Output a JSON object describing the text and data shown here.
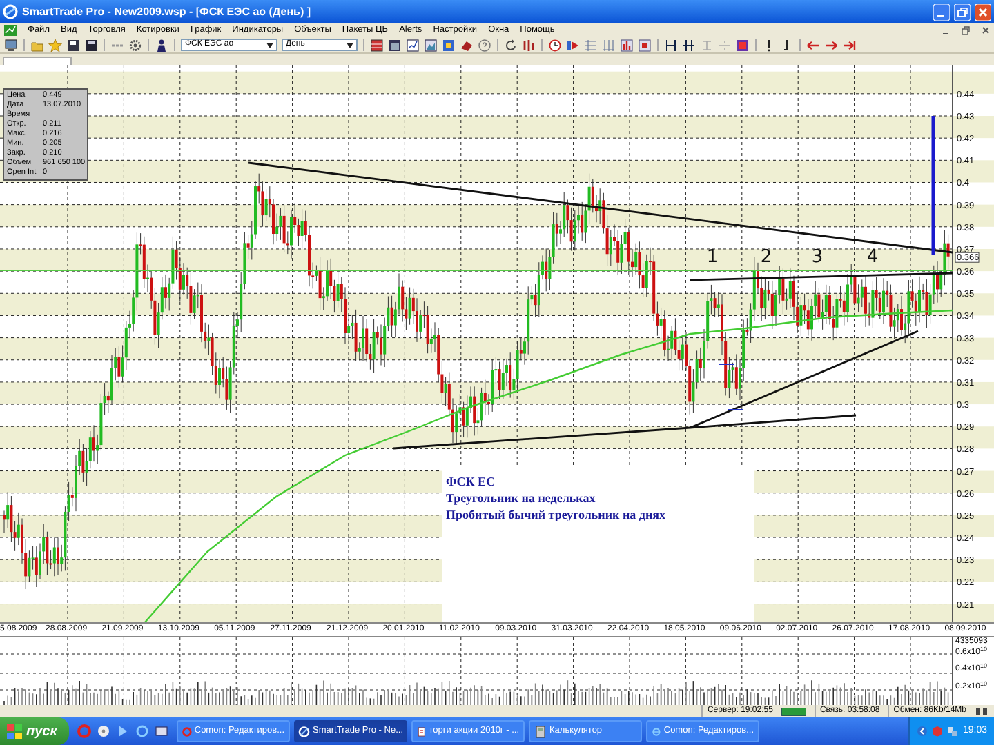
{
  "window": {
    "title": "SmartTrade Pro - New2009.wsp - [ФСК ЕЭС ао (День) ]"
  },
  "menu": [
    "Файл",
    "Вид",
    "Торговля",
    "Котировки",
    "График",
    "Индикаторы",
    "Объекты",
    "Пакеты ЦБ",
    "Alerts",
    "Настройки",
    "Окна",
    "Помощь"
  ],
  "toolbar": {
    "instrument": "ФСК ЕЭС ао",
    "period": "День"
  },
  "info_box": [
    {
      "label": "Цена",
      "value": "0.449"
    },
    {
      "label": "Дата",
      "value": "13.07.2010"
    },
    {
      "label": "Время"
    },
    {
      "label": "Откр.",
      "value": "0.211"
    },
    {
      "label": "Макс.",
      "value": "0.216"
    },
    {
      "label": "Мин.",
      "value": "0.205"
    },
    {
      "label": "Закр.",
      "value": "0.210"
    },
    {
      "label": "Объем",
      "value": "961 650 100"
    },
    {
      "label": "Open Int",
      "value": "0"
    }
  ],
  "price_axis": {
    "ticks": [
      "0.44",
      "0.43",
      "0.42",
      "0.41",
      "0.4",
      "0.39",
      "0.38",
      "0.37",
      "0.36",
      "0.35",
      "0.34",
      "0.33",
      "0.32",
      "0.31",
      "0.3",
      "0.29",
      "0.28",
      "0.27",
      "0.26",
      "0.25",
      "0.24",
      "0.23",
      "0.22",
      "0.21"
    ],
    "last_price": "0.366"
  },
  "pattern_labels": [
    "1",
    "2",
    "3",
    "4"
  ],
  "annotation": [
    "ФСК ЕС",
    "Треугольник на недельках",
    "Пробитый бычий треугольник на днях"
  ],
  "date_axis": [
    "5.08.2009",
    "28.08.2009",
    "21.09.2009",
    "13.10.2009",
    "05.11.2009",
    "27.11.2009",
    "21.12.2009",
    "20.01.2010",
    "11.02.2010",
    "09.03.2010",
    "31.03.2010",
    "22.04.2010",
    "18.05.2010",
    "09.06.2010",
    "02.07.2010",
    "26.07.2010",
    "17.08.2010",
    "08.09.2010"
  ],
  "volume_axis": [
    "4335093",
    "0.6x10$^{10}$",
    "0.4x10$^{10}$",
    "0.2x10$^{10}$"
  ],
  "status_bar": [
    "Сервер: 19:02:55",
    "Связь: 03:58:08",
    "Обмен: 86Kb/14Mb"
  ],
  "taskbar": {
    "start": "пуск",
    "tasks": [
      {
        "label": "Comon: Редактиров...",
        "kind": "opera",
        "selected": false
      },
      {
        "label": "SmartTrade Pro - Ne...",
        "kind": "app",
        "selected": true
      },
      {
        "label": "торги акции 2010г - ...",
        "kind": "document",
        "selected": false
      },
      {
        "label": "Калькулятор",
        "kind": "calculator",
        "selected": false
      },
      {
        "label": "Comon: Редактиров...",
        "kind": "browser",
        "selected": false
      }
    ],
    "clock": "19:03"
  }
}
